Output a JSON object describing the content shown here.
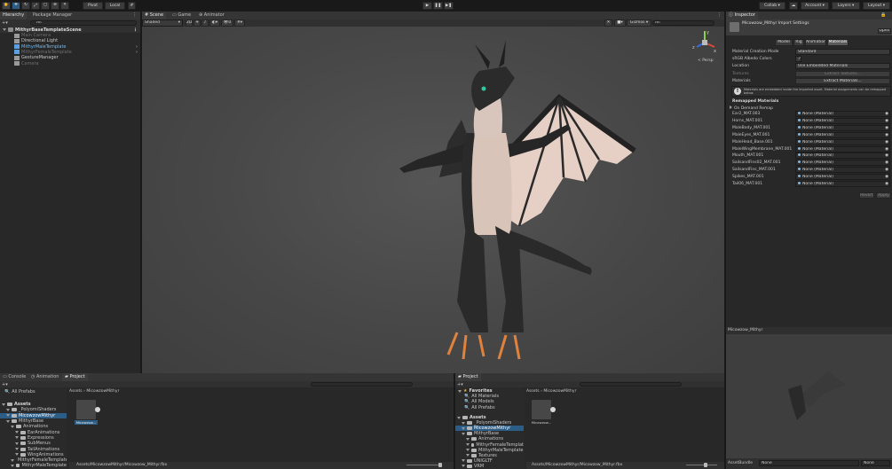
{
  "toolbar": {
    "pivot": "Pivot",
    "local": "Local",
    "collab": "Collab",
    "account": "Account",
    "layers": "Layers",
    "layout": "Layout"
  },
  "hierarchy": {
    "tab": "Hierarchy",
    "tab2": "Package Manager",
    "search_placeholder": "All",
    "scene": "MithyrBaseTemplateScene",
    "items": [
      {
        "label": "Main Camera",
        "dim": true
      },
      {
        "label": "Directional Light",
        "dim": false
      },
      {
        "label": "MithyrMaleTemplate",
        "dim": false,
        "blue": true
      },
      {
        "label": "MithyrFemaleTemplate",
        "dim": true,
        "blue": true
      },
      {
        "label": "GestureManager",
        "dim": false
      },
      {
        "label": "Camera",
        "dim": true
      }
    ]
  },
  "scene_view": {
    "tabs": [
      "Scene",
      "Game",
      "Animator"
    ],
    "shading": "Shaded",
    "mode_2d": "2D",
    "gizmos": "Gizmos",
    "search": "All",
    "persp": "< Persp",
    "axis_x": "x",
    "axis_y": "y",
    "axis_z": "z"
  },
  "inspector": {
    "tab": "Inspector",
    "title": "Micowzow_Mithyr Import Settings",
    "open": "Open",
    "tabs": [
      "Model",
      "Rig",
      "Animation",
      "Materials"
    ],
    "props": [
      {
        "label": "Material Creation Mode",
        "value": "Standard"
      },
      {
        "label": "sRGB Albedo Colors",
        "value": "✓"
      },
      {
        "label": "Location",
        "value": "Use Embedded Materials"
      }
    ],
    "textures_label": "Textures",
    "textures_btn": "Extract Textures...",
    "materials_label": "Materials",
    "materials_btn": "Extract Materials...",
    "info": "Materials are embedded inside the imported asset. Material assignments can be remapped below.",
    "remapped": "Remapped Materials",
    "ondemand": "On Demand Remap",
    "materials": [
      {
        "name": "Ear2_MAT.003",
        "value": "None (Material)"
      },
      {
        "name": "Horns_MAT.001",
        "value": "None (Material)"
      },
      {
        "name": "MaleBody_MAT.001",
        "value": "None (Material)"
      },
      {
        "name": "MaleEyes_MAT.001",
        "value": "None (Material)"
      },
      {
        "name": "MaleHead_Base.001",
        "value": "None (Material)"
      },
      {
        "name": "MaleWingMembrane_MAT.001",
        "value": "None (Material)"
      },
      {
        "name": "Mouth_MAT.001",
        "value": "None (Material)"
      },
      {
        "name": "SailsandFins02_MAT.001",
        "value": "None (Material)"
      },
      {
        "name": "SailsandFins_MAT.001",
        "value": "None (Material)"
      },
      {
        "name": "Spikes_MAT.001",
        "value": "None (Material)"
      },
      {
        "name": "Tail06_MAT.001",
        "value": "None (Material)"
      }
    ],
    "revert": "Revert",
    "apply": "Apply",
    "preview_title": "Micowzow_Mithyr",
    "assetbundle": "AssetBundle",
    "ab_value": "None",
    "ab_variant": "None"
  },
  "console": {
    "tabs": [
      "Console",
      "Animation",
      "Project"
    ],
    "favorites": [
      "All Prefabs"
    ],
    "breadcrumb": [
      "Assets",
      "MicowzowMithyr"
    ],
    "tree": [
      {
        "label": "Assets",
        "indent": 0,
        "bold": true
      },
      {
        "label": "_PolyomiShaders",
        "indent": 1
      },
      {
        "label": "MicowzowMithyr",
        "indent": 1,
        "sel": true
      },
      {
        "label": "MithyrBase",
        "indent": 1
      },
      {
        "label": "Animations",
        "indent": 2
      },
      {
        "label": "EarAnimations",
        "indent": 3
      },
      {
        "label": "Expressions",
        "indent": 3
      },
      {
        "label": "SubMenus",
        "indent": 3
      },
      {
        "label": "TailAnimations",
        "indent": 3
      },
      {
        "label": "WingAnimations",
        "indent": 3
      },
      {
        "label": "MithyrFemaleTemplate",
        "indent": 2
      },
      {
        "label": "MithyrMaleTemplate",
        "indent": 2
      }
    ],
    "asset_label": "Micowzow...",
    "path": "Assets/MicowzowMithyr/Micowzow_Mithyr.fbx"
  },
  "project": {
    "tab": "Project",
    "fav_title": "Favorites",
    "favorites": [
      "All Materials",
      "All Models",
      "All Prefabs"
    ],
    "breadcrumb": [
      "Assets",
      "MicowzowMithyr"
    ],
    "tree": [
      {
        "label": "Assets",
        "indent": 0,
        "bold": true
      },
      {
        "label": "_PolyomiShaders",
        "indent": 1
      },
      {
        "label": "MicowzowMithyr",
        "indent": 1,
        "sel": true
      },
      {
        "label": "MithyrBase",
        "indent": 1
      },
      {
        "label": "Animations",
        "indent": 2
      },
      {
        "label": "MithyrFemaleTemplat",
        "indent": 2
      },
      {
        "label": "MithyrMaleTemplate",
        "indent": 2
      },
      {
        "label": "Textures",
        "indent": 2
      },
      {
        "label": "UNIGLTF",
        "indent": 1
      },
      {
        "label": "VRM",
        "indent": 1
      }
    ],
    "asset_label": "Micowzow...",
    "path": "Assets/MicowzowMithyr/Micowzow_Mithyr.fbx"
  },
  "colors": {
    "accent": "#3a72b0",
    "selection": "#2c5d87",
    "viewport": "#474747"
  }
}
